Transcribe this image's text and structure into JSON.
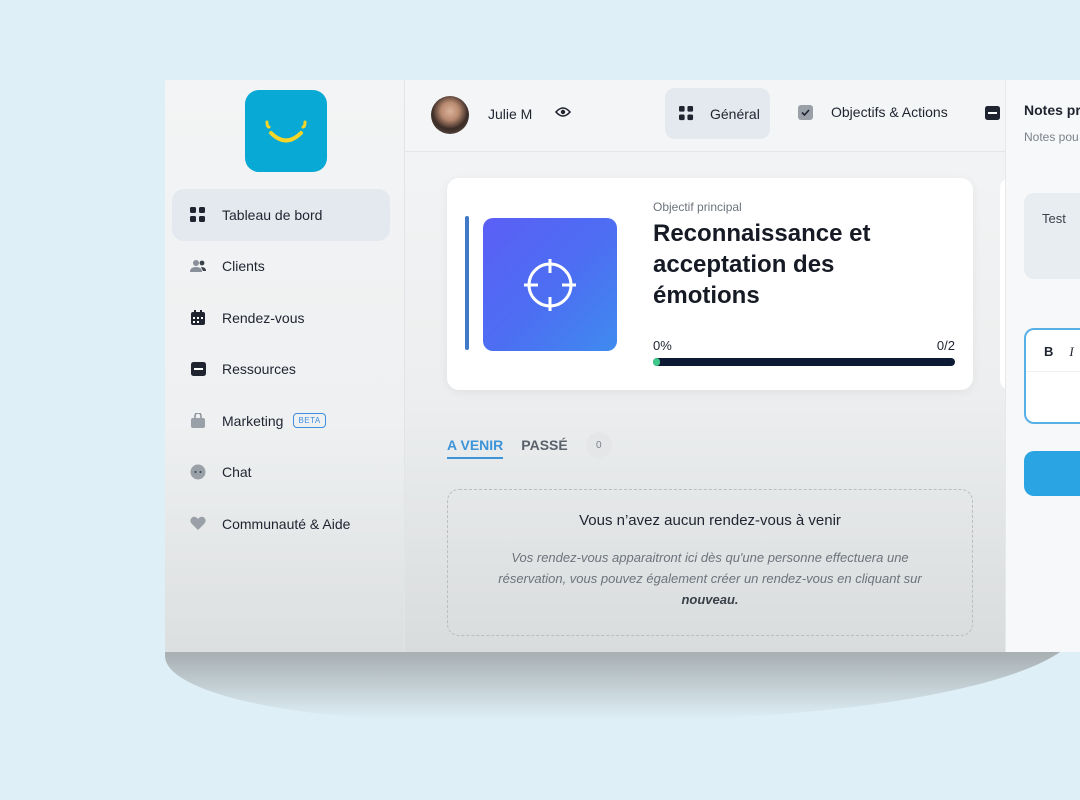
{
  "sidebar": {
    "items": [
      {
        "label": "Tableau de bord",
        "icon": "dashboard-icon",
        "active": true
      },
      {
        "label": "Clients",
        "icon": "users-icon"
      },
      {
        "label": "Rendez-vous",
        "icon": "calendar-icon"
      },
      {
        "label": "Ressources",
        "icon": "folder-icon"
      },
      {
        "label": "Marketing",
        "icon": "shopping-bag-icon",
        "badge": "BETA"
      },
      {
        "label": "Chat",
        "icon": "chat-icon"
      },
      {
        "label": "Communauté & Aide",
        "icon": "heart-icon"
      }
    ]
  },
  "header": {
    "user_name": "Julie M",
    "tabs": [
      {
        "label": "Général",
        "active": true
      },
      {
        "label": "Objectifs & Actions"
      }
    ]
  },
  "objective": {
    "label": "Objectif principal",
    "title": "Reconnaissance et acceptation des émotions",
    "progress_text": "0%",
    "progress_ratio": "0/2",
    "progress_value": 0
  },
  "appointments": {
    "tab_upcoming": "A VENIR",
    "tab_past": "PASSÉ",
    "count": "0",
    "empty_title": "Vous n’avez aucun rendez-vous à venir",
    "empty_desc": "Vos rendez-vous apparaitront ici dès qu'une personne effectuera une réservation, vous pouvez également créer un rendez-vous en cliquant sur",
    "empty_desc_bold": "nouveau."
  },
  "notes": {
    "title": "Notes pr",
    "subtitle": "Notes pou",
    "note_text": "Test",
    "bold_label": "B",
    "italic_label": "I"
  },
  "colors": {
    "accent": "#2aa4e3",
    "logo": "#09a9d6",
    "progress_track": "#0d1a33",
    "progress_fill": "#3ec98a"
  }
}
